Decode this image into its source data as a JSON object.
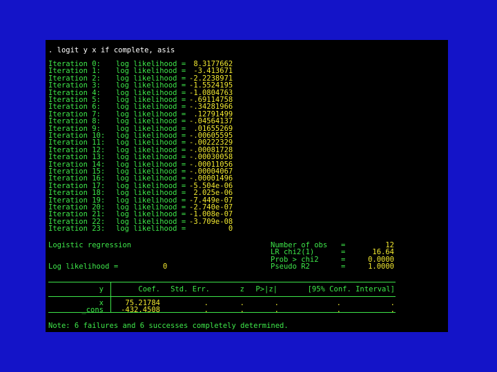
{
  "command": ". logit y x if complete, asis",
  "iterations": [
    {
      "label": "Iteration 0:",
      "text": "log likelihood =",
      "value": " 8.3177662"
    },
    {
      "label": "Iteration 1:",
      "text": "log likelihood =",
      "value": " -3.413671"
    },
    {
      "label": "Iteration 2:",
      "text": "log likelihood =",
      "value": "-2.2238971"
    },
    {
      "label": "Iteration 3:",
      "text": "log likelihood =",
      "value": "-1.5524195"
    },
    {
      "label": "Iteration 4:",
      "text": "log likelihood =",
      "value": "-1.0804763"
    },
    {
      "label": "Iteration 5:",
      "text": "log likelihood =",
      "value": "-.69114758"
    },
    {
      "label": "Iteration 6:",
      "text": "log likelihood =",
      "value": "-.34281966"
    },
    {
      "label": "Iteration 7:",
      "text": "log likelihood =",
      "value": " .12791499"
    },
    {
      "label": "Iteration 8:",
      "text": "log likelihood =",
      "value": "-.04564137"
    },
    {
      "label": "Iteration 9:",
      "text": "log likelihood =",
      "value": " .01655269"
    },
    {
      "label": "Iteration 10:",
      "text": "log likelihood =",
      "value": "-.00605595"
    },
    {
      "label": "Iteration 11:",
      "text": "log likelihood =",
      "value": "-.00222329"
    },
    {
      "label": "Iteration 12:",
      "text": "log likelihood =",
      "value": "-.00081728"
    },
    {
      "label": "Iteration 13:",
      "text": "log likelihood =",
      "value": "-.00030058"
    },
    {
      "label": "Iteration 14:",
      "text": "log likelihood =",
      "value": "-.00011056"
    },
    {
      "label": "Iteration 15:",
      "text": "log likelihood =",
      "value": "-.00004067"
    },
    {
      "label": "Iteration 16:",
      "text": "log likelihood =",
      "value": "-.00001496"
    },
    {
      "label": "Iteration 17:",
      "text": "log likelihood =",
      "value": "-5.504e-06"
    },
    {
      "label": "Iteration 18:",
      "text": "log likelihood =",
      "value": " 2.025e-06"
    },
    {
      "label": "Iteration 19:",
      "text": "log likelihood =",
      "value": "-7.449e-07"
    },
    {
      "label": "Iteration 20:",
      "text": "log likelihood =",
      "value": "-2.740e-07"
    },
    {
      "label": "Iteration 21:",
      "text": "log likelihood =",
      "value": "-1.008e-07"
    },
    {
      "label": "Iteration 22:",
      "text": "log likelihood =",
      "value": "-3.709e-08"
    },
    {
      "label": "Iteration 23:",
      "text": "log likelihood =",
      "value": "         0"
    }
  ],
  "summary": {
    "title": "Logistic regression",
    "loglik_label": "Log likelihood =",
    "loglik_value": "0",
    "stats": [
      {
        "label": "Number of obs",
        "eq": "=",
        "value": "12"
      },
      {
        "label": "LR chi2(1)",
        "eq": "=",
        "value": "16.64"
      },
      {
        "label": "Prob > chi2",
        "eq": "=",
        "value": "0.0000"
      },
      {
        "label": "Pseudo R2",
        "eq": "=",
        "value": "1.0000"
      }
    ]
  },
  "table": {
    "headers": [
      "y",
      "Coef.",
      "Std. Err.",
      "z",
      "P>|z|",
      "[95% Conf. Interval]"
    ],
    "rows": [
      {
        "var": "x",
        "coef": "75.21784",
        "se": ".",
        "z": ".",
        "p": ".",
        "lo": ".",
        "hi": "."
      },
      {
        "var": "_cons",
        "coef": "-432.4508",
        "se": ".",
        "z": ".",
        "p": ".",
        "lo": ".",
        "hi": "."
      }
    ]
  },
  "note": "Note: 6 failures and 6 successes completely determined."
}
